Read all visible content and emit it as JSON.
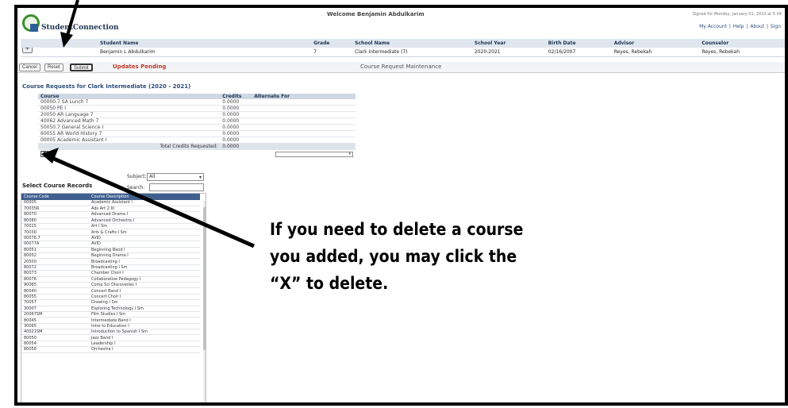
{
  "header": {
    "app_name": "StudentConnection",
    "welcome": "Welcome Benjamin Abdulkarim",
    "signed_in": "Signed for Monday, January 01, 2022 at 5:04",
    "links": [
      "My Account",
      "Help",
      "About",
      "Sign"
    ]
  },
  "student": {
    "headers": [
      "Student Name",
      "Grade",
      "School Name",
      "School Year",
      "Birth Date",
      "Advisor",
      "Counselor"
    ],
    "row": [
      "Benjamin L Abdulkarim",
      "7",
      "Clark Intermediate (7)",
      "2020-2021",
      "02/16/2007",
      "Reyes, Rebekah",
      "Reyes, Rebekah"
    ]
  },
  "toolbar": {
    "cancel": "Cancel",
    "reset": "Reset",
    "submit": "Submit",
    "pending": "Updates Pending",
    "title": "Course Request Maintenance"
  },
  "requests": {
    "title": "Course Requests for Clark Intermediate (2020 - 2021)",
    "headers": [
      "Course",
      "Credits",
      "Alternate For"
    ],
    "rows": [
      {
        "course": "00000.7 SA Lunch 7",
        "credits": "0.0000"
      },
      {
        "course": "00050 PE I",
        "credits": "0.0000"
      },
      {
        "course": "20050 AR Language 7",
        "credits": "0.0000"
      },
      {
        "course": "40062 Advanced Math 7",
        "credits": "0.0000"
      },
      {
        "course": "50050.7 General Science I",
        "credits": "0.0000"
      },
      {
        "course": "60055 AR World History 7",
        "credits": "0.0000"
      },
      {
        "course": "00005 Academic Assistant I",
        "credits": "0.0000"
      }
    ],
    "delete_symbol": "X",
    "total_label": "Total Credits Requested:",
    "total_value": "0.0000"
  },
  "select": {
    "title": "Select Course Records",
    "subject_label": "Subject:",
    "subject_value": "All",
    "search_label": "Search:",
    "headers": [
      "Course Code",
      "Course Description"
    ],
    "rows": [
      [
        "00005",
        "Academic Assistant I"
      ],
      [
        "70035R",
        "Ads Art 2 III"
      ],
      [
        "80070",
        "Advanced Drama I"
      ],
      [
        "80080",
        "Advanced Orchestra I"
      ],
      [
        "70015",
        "Art I Sm"
      ],
      [
        "70030",
        "Arts & Crafts I Sm"
      ],
      [
        "00076.7",
        "AVID"
      ],
      [
        "00077A",
        "AVID"
      ],
      [
        "80051",
        "Beginning Band I"
      ],
      [
        "80052",
        "Beginning Drama I"
      ],
      [
        "20500",
        "Broadcasting I"
      ],
      [
        "80072",
        "Broadcasting I Sm"
      ],
      [
        "80073",
        "Chamber Choir I"
      ],
      [
        "80076",
        "Collaborative Pedagogy I"
      ],
      [
        "90065",
        "Comp Sci Discoveries I"
      ],
      [
        "80040",
        "Concert Band I"
      ],
      [
        "80055",
        "Concert Choir I"
      ],
      [
        "70057",
        "Drawing I Sm"
      ],
      [
        "30007",
        "Exploring Technology I Sm"
      ],
      [
        "20067SM",
        "Film Studies I Sm"
      ],
      [
        "80045",
        "Intermediate Band I"
      ],
      [
        "30065",
        "Intro to Education I"
      ],
      [
        "40021SM",
        "Introduction to Spanish I Sm"
      ],
      [
        "80050",
        "Jazz Band I"
      ],
      [
        "80054",
        "Leadership I"
      ],
      [
        "80058",
        "Orchestra I"
      ]
    ]
  },
  "instruction": "If you need to delete a course you added, you may click the “X” to delete."
}
